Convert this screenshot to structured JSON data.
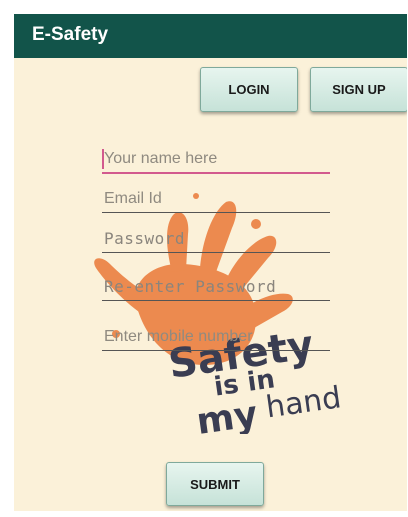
{
  "appbar": {
    "title": "E-Safety"
  },
  "buttons": {
    "login": "LOGIN",
    "signup": "SIGN UP",
    "submit": "SUBMIT"
  },
  "form": {
    "name_placeholder": "Your name here",
    "email_placeholder": "Email Id",
    "password_placeholder": "Password",
    "reenter_placeholder": "Re-enter Password",
    "mobile_placeholder": "Enter mobile number"
  },
  "watermark": {
    "line1": "Safety",
    "line2": "is in",
    "line3_a": "my",
    "line3_b": "hand"
  },
  "colors": {
    "appbar": "#12544a",
    "background": "#fbf1d9",
    "hand": "#ec8a4f",
    "accent": "#d25a8e"
  }
}
